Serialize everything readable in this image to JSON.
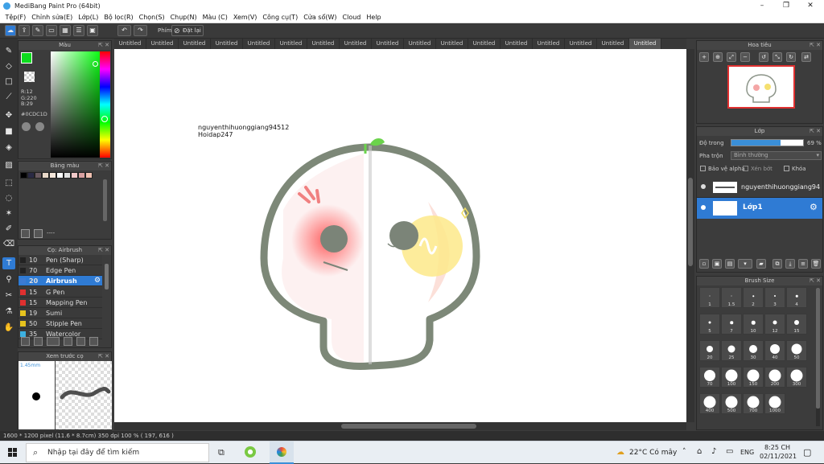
{
  "window": {
    "title": "MediBang Paint Pro (64bit)"
  },
  "menu": [
    "Tệp(F)",
    "Chỉnh sửa(E)",
    "Lớp(L)",
    "Bộ lọc(R)",
    "Chọn(S)",
    "Chụp(N)",
    "Màu (C)",
    "Xem(V)",
    "Công cụ(T)",
    "Cửa sổ(W)",
    "Cloud",
    "Help"
  ],
  "toolbar": {
    "hand_label": "Phím",
    "reset_label": "Đặt lại"
  },
  "color_panel": {
    "title": "Màu",
    "r": "R:12",
    "g": "G:220",
    "b": "B:29",
    "hex": "#0CDC1D",
    "fg": "#0cdc1d"
  },
  "palette_panel": {
    "title": "Bảng màu",
    "dash": "----",
    "swatches": [
      "#000000",
      "#2a2a44",
      "#6a5a60",
      "#e8d8c8",
      "#f3e6da",
      "#ffffff",
      "#e0e0e0",
      "#f0c8c8",
      "#d8a0a0",
      "#f0c0b0"
    ]
  },
  "brush_panel": {
    "title": "Cọ: Airbrush",
    "rows": [
      {
        "size": "10",
        "name": "Pen (Sharp)",
        "color": "#222222"
      },
      {
        "size": "70",
        "name": "Edge Pen",
        "color": "#222222"
      },
      {
        "size": "20",
        "name": "Airbrush",
        "color": "#3c7bd4"
      },
      {
        "size": "15",
        "name": "G Pen",
        "color": "#e03030"
      },
      {
        "size": "15",
        "name": "Mapping Pen",
        "color": "#e03030"
      },
      {
        "size": "19",
        "name": "Sumi",
        "color": "#e6c31e"
      },
      {
        "size": "50",
        "name": "Stipple Pen",
        "color": "#e6c31e"
      },
      {
        "size": "35",
        "name": "Watercolor",
        "color": "#3cb0e0"
      }
    ]
  },
  "preview_panel": {
    "title": "Xem trước cọ",
    "size": "1.45mm"
  },
  "tabs": [
    "Untitled",
    "Untitled",
    "Untitled",
    "Untitled",
    "Untitled",
    "Untitled",
    "Untitled",
    "Untitled",
    "Untitled",
    "Untitled",
    "Untitled",
    "Untitled",
    "Untitled",
    "Untitled",
    "Untitled",
    "Untitled",
    "Untitled"
  ],
  "canvas": {
    "text_line1": "nguyenthihuonggiang94512",
    "text_line2": "Hoidap247"
  },
  "navigator": {
    "title": "Hoa tiêu"
  },
  "layer_panel": {
    "title": "Lớp",
    "opacity_label": "Độ trong",
    "opacity_value": "69 %",
    "opacity_pct": 69,
    "blend_label": "Pha trộn",
    "blend_value": "Bình thường",
    "protect_alpha": "Bảo vệ alpha",
    "clipping": "Xén bớt",
    "lock": "Khóa",
    "layers": [
      {
        "name": "nguyenthihuonggiang94"
      },
      {
        "name": "Lớp1"
      }
    ]
  },
  "brush_size_panel": {
    "title": "Brush Size",
    "sizes": [
      "1",
      "1.5",
      "2",
      "3",
      "4",
      "5",
      "7",
      "10",
      "12",
      "15",
      "20",
      "25",
      "30",
      "40",
      "50",
      "70",
      "100",
      "150",
      "200",
      "300",
      "400",
      "500",
      "700",
      "1000"
    ]
  },
  "status": {
    "text": "1600 * 1200 pixel   (11.6 * 8.7cm)   350 dpi   100 %   ( 197, 616 )"
  },
  "taskbar": {
    "search_placeholder": "Nhập tại đây để tìm kiếm",
    "weather": "22°C  Có mây",
    "lang": "ENG",
    "time": "8:25 CH",
    "date": "02/11/2021"
  }
}
